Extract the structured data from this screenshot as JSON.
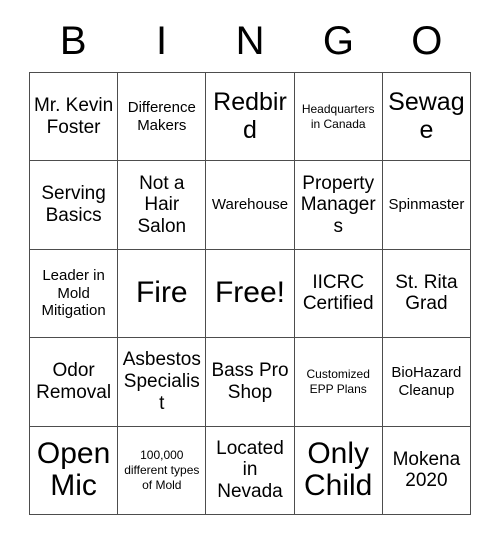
{
  "header": {
    "letters": [
      "B",
      "I",
      "N",
      "G",
      "O"
    ]
  },
  "grid": {
    "rows": [
      [
        {
          "text": "Mr. Kevin Foster",
          "size": "md"
        },
        {
          "text": "Difference Makers",
          "size": "sm"
        },
        {
          "text": "Redbird",
          "size": "lg"
        },
        {
          "text": "Headquarters in Canada",
          "size": "xs"
        },
        {
          "text": "Sewage",
          "size": "lg"
        }
      ],
      [
        {
          "text": "Serving Basics",
          "size": "md"
        },
        {
          "text": "Not a Hair Salon",
          "size": "md"
        },
        {
          "text": "Warehouse",
          "size": "sm"
        },
        {
          "text": "Property Managers",
          "size": "md"
        },
        {
          "text": "Spinmaster",
          "size": "sm"
        }
      ],
      [
        {
          "text": "Leader in Mold Mitigation",
          "size": "sm"
        },
        {
          "text": "Fire",
          "size": "xl"
        },
        {
          "text": "Free!",
          "size": "xl"
        },
        {
          "text": "IICRC Certified",
          "size": "md"
        },
        {
          "text": "St. Rita Grad",
          "size": "md"
        }
      ],
      [
        {
          "text": "Odor Removal",
          "size": "md"
        },
        {
          "text": "Asbestos Specialist",
          "size": "md"
        },
        {
          "text": "Bass Pro Shop",
          "size": "md"
        },
        {
          "text": "Customized EPP Plans",
          "size": "xs"
        },
        {
          "text": "BioHazard Cleanup",
          "size": "sm"
        }
      ],
      [
        {
          "text": "Open Mic",
          "size": "xl"
        },
        {
          "text": "100,000 different types of Mold",
          "size": "xs"
        },
        {
          "text": "Located in Nevada",
          "size": "md"
        },
        {
          "text": "Only Child",
          "size": "xl"
        },
        {
          "text": "Mokena 2020",
          "size": "md"
        }
      ]
    ]
  },
  "colors": {
    "border": "#4d4d4d",
    "text": "#000000",
    "background": "#ffffff"
  }
}
